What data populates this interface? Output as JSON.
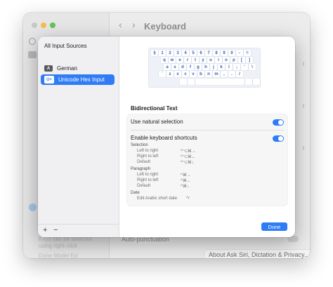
{
  "window": {
    "title": "Keyboard",
    "back_glyph": "‹",
    "forward_glyph": "›",
    "sidebar_texts": [
      "Keys can be selected",
      "using right-click",
      "Done Model Ed"
    ],
    "autopunctuation_label": "Auto-punctuation",
    "about_button": "About Ask Siri, Dictation & Privacy..."
  },
  "sources": {
    "header": "All Input Sources",
    "items": [
      {
        "badge": "A",
        "label": "German",
        "selected": false
      },
      {
        "badge": "U+",
        "label": "Unicode Hex Input",
        "selected": true
      }
    ],
    "add": "+",
    "remove": "−"
  },
  "keyboard": {
    "rows": [
      [
        "§",
        "1",
        "2",
        "3",
        "4",
        "5",
        "6",
        "7",
        "8",
        "9",
        "0",
        "-",
        "="
      ],
      [
        "q",
        "w",
        "e",
        "r",
        "t",
        "y",
        "u",
        "i",
        "o",
        "p",
        "[",
        "]"
      ],
      [
        "a",
        "s",
        "d",
        "f",
        "g",
        "h",
        "j",
        "k",
        "l",
        ";",
        "'",
        "\\"
      ],
      [
        "`",
        "z",
        "x",
        "c",
        "v",
        "b",
        "n",
        "m",
        ",",
        ".",
        "/"
      ]
    ]
  },
  "bidi": {
    "title": "Bidirectional Text",
    "natural_selection": {
      "label": "Use natural selection",
      "on": true
    },
    "shortcuts": {
      "label": "Enable keyboard shortcuts",
      "on": true,
      "groups": [
        {
          "name": "Selection",
          "items": [
            {
              "label": "Left to right",
              "shortcut": "^⌥⌘→"
            },
            {
              "label": "Right to left",
              "shortcut": "^⌥⌘←"
            },
            {
              "label": "Default",
              "shortcut": "^⌥⌘↓"
            }
          ]
        },
        {
          "name": "Paragraph",
          "items": [
            {
              "label": "Left to right",
              "shortcut": "^⌘→"
            },
            {
              "label": "Right to left",
              "shortcut": "^⌘←"
            },
            {
              "label": "Default",
              "shortcut": "^⌘↓"
            }
          ]
        },
        {
          "name": "Date",
          "items": [
            {
              "label": "Edit Arabic short date",
              "shortcut": "^/"
            }
          ]
        }
      ]
    }
  },
  "done_label": "Done",
  "colors": {
    "accent": "#2f7cf6",
    "key_text": "#2f5fb8"
  }
}
